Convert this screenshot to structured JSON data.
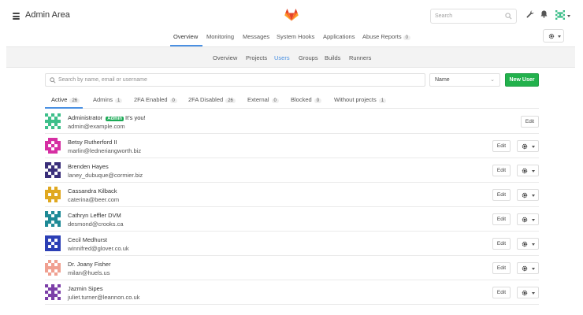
{
  "header": {
    "title": "Admin Area",
    "search_placeholder": "Search"
  },
  "main_tabs": [
    {
      "label": "Overview",
      "active": true
    },
    {
      "label": "Monitoring"
    },
    {
      "label": "Messages"
    },
    {
      "label": "System Hooks"
    },
    {
      "label": "Applications"
    },
    {
      "label": "Abuse Reports",
      "badge": "0"
    }
  ],
  "sub_tabs": [
    {
      "label": "Overview"
    },
    {
      "label": "Projects"
    },
    {
      "label": "Users",
      "active": true
    },
    {
      "label": "Groups"
    },
    {
      "label": "Builds"
    },
    {
      "label": "Runners"
    }
  ],
  "filter": {
    "search_placeholder": "Search by name, email or username",
    "sort_value": "Name",
    "new_user_label": "New User"
  },
  "filter_tabs": [
    {
      "label": "Active",
      "count": "26",
      "active": true
    },
    {
      "label": "Admins",
      "count": "1"
    },
    {
      "label": "2FA Enabled",
      "count": "0"
    },
    {
      "label": "2FA Disabled",
      "count": "26"
    },
    {
      "label": "External",
      "count": "0"
    },
    {
      "label": "Blocked",
      "count": "0"
    },
    {
      "label": "Without projects",
      "count": "1"
    }
  ],
  "users": [
    {
      "name": "Administrator",
      "badge": "Admin",
      "note": "It's you!",
      "email": "admin@example.com",
      "edit": "Edit",
      "color": "#3dbf8a",
      "has_gear": false
    },
    {
      "name": "Betsy Rutherford II",
      "email": "marlin@ledneriangworth.biz",
      "edit": "Edit",
      "color": "#d62fa3",
      "has_gear": true
    },
    {
      "name": "Brenden Hayes",
      "email": "laney_dubuque@cormier.biz",
      "edit": "Edit",
      "color": "#3a2f7a",
      "has_gear": true
    },
    {
      "name": "Cassandra Kilback",
      "email": "caterina@beer.com",
      "edit": "Edit",
      "color": "#e0a820",
      "has_gear": true
    },
    {
      "name": "Cathryn Leffler DVM",
      "email": "desmond@crooks.ca",
      "edit": "Edit",
      "color": "#1f8a96",
      "has_gear": true
    },
    {
      "name": "Cecil Medhurst",
      "email": "winnifred@glover.co.uk",
      "edit": "Edit",
      "color": "#2c3fb5",
      "has_gear": true
    },
    {
      "name": "Dr. Joany Fisher",
      "email": "milan@huels.us",
      "edit": "Edit",
      "color": "#f0a090",
      "has_gear": true
    },
    {
      "name": "Jazmin Sipes",
      "email": "juliet.turner@leannon.co.uk",
      "edit": "Edit",
      "color": "#7c3fa8",
      "has_gear": true
    }
  ]
}
